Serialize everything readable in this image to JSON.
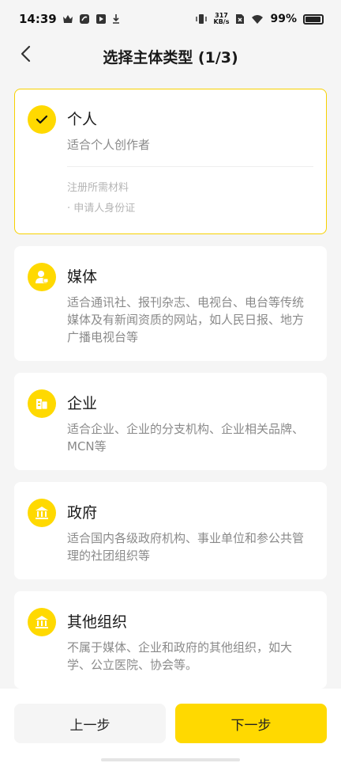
{
  "status_bar": {
    "time": "14:39",
    "net_speed_value": "317",
    "net_speed_unit": "KB/s",
    "battery": "99%"
  },
  "header": {
    "title": "选择主体类型 (1/3)"
  },
  "cards": [
    {
      "title": "个人",
      "desc": "适合个人创作者",
      "materials_label": "注册所需材料",
      "materials_item": "· 申请人身份证",
      "selected": true
    },
    {
      "title": "媒体",
      "desc": "适合通讯社、报刊杂志、电视台、电台等传统媒体及有新闻资质的网站，如人民日报、地方广播电视台等"
    },
    {
      "title": "企业",
      "desc": "适合企业、企业的分支机构、企业相关品牌、MCN等"
    },
    {
      "title": "政府",
      "desc": "适合国内各级政府机构、事业单位和参公共管理的社团组织等"
    },
    {
      "title": "其他组织",
      "desc": "不属于媒体、企业和政府的其他组织，如大学、公立医院、协会等。"
    }
  ],
  "buttons": {
    "prev": "上一步",
    "next": "下一步"
  },
  "colors": {
    "accent": "#ffd900",
    "selected_border": "#f7d100"
  },
  "icons": [
    "back-arrow-icon",
    "check-icon",
    "media-person-icon",
    "enterprise-building-icon",
    "government-building-icon",
    "organization-building-icon"
  ]
}
